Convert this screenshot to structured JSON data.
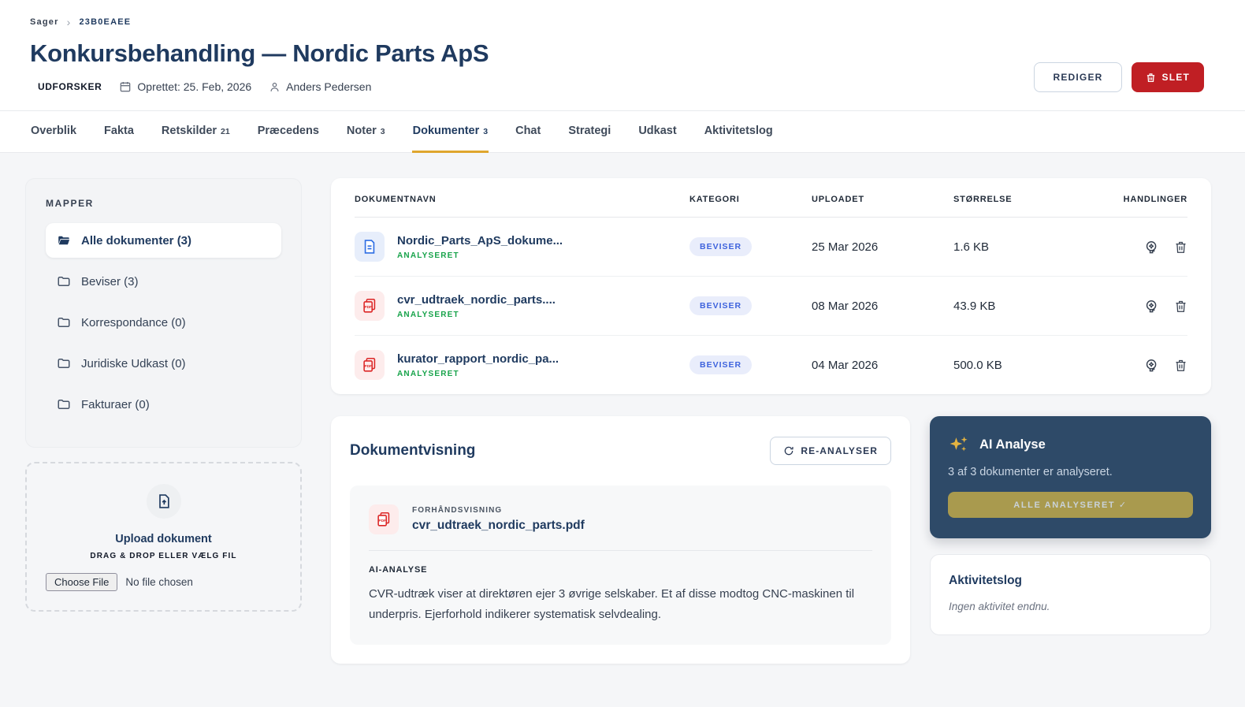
{
  "breadcrumb": {
    "root": "Sager",
    "separator": "›",
    "current": "23B0EAEE"
  },
  "header": {
    "title": "Konkursbehandling — Nordic Parts ApS",
    "role_badge": "UDFORSKER",
    "created": "Oprettet: 25. Feb, 2026",
    "owner": "Anders Pedersen",
    "edit_label": "REDIGER",
    "delete_label": "SLET"
  },
  "tabs": [
    {
      "label": "Overblik"
    },
    {
      "label": "Fakta"
    },
    {
      "label": "Retskilder",
      "count": "21"
    },
    {
      "label": "Præcedens"
    },
    {
      "label": "Noter",
      "count": "3"
    },
    {
      "label": "Dokumenter",
      "count": "3",
      "active": true
    },
    {
      "label": "Chat"
    },
    {
      "label": "Strategi"
    },
    {
      "label": "Udkast"
    },
    {
      "label": "Aktivitetslog"
    }
  ],
  "folders": {
    "title": "MAPPER",
    "items": [
      {
        "label": "Alle dokumenter (3)",
        "active": true
      },
      {
        "label": "Beviser (3)"
      },
      {
        "label": "Korrespondance (0)"
      },
      {
        "label": "Juridiske Udkast (0)"
      },
      {
        "label": "Fakturaer (0)"
      }
    ]
  },
  "upload": {
    "title": "Upload dokument",
    "subtitle": "DRAG & DROP ELLER VÆLG FIL",
    "file_button": "Choose File",
    "file_status": "No file chosen"
  },
  "table": {
    "headers": [
      "DOKUMENTNAVN",
      "KATEGORI",
      "UPLOADET",
      "STØRRELSE",
      "HANDLINGER"
    ],
    "rows": [
      {
        "name": "Nordic_Parts_ApS_dokume...",
        "status": "ANALYSERET",
        "category": "BEVISER",
        "uploaded": "25 Mar 2026",
        "size": "1.6 KB",
        "file_type": "doc"
      },
      {
        "name": "cvr_udtraek_nordic_parts....",
        "status": "ANALYSERET",
        "category": "BEVISER",
        "uploaded": "08 Mar 2026",
        "size": "43.9 KB",
        "file_type": "pdf"
      },
      {
        "name": "kurator_rapport_nordic_pa...",
        "status": "ANALYSERET",
        "category": "BEVISER",
        "uploaded": "04 Mar 2026",
        "size": "500.0 KB",
        "file_type": "pdf"
      }
    ]
  },
  "viewer": {
    "title": "Dokumentvisning",
    "reanalyze_label": "RE-ANALYSER",
    "preview_label": "FORHÅNDSVISNING",
    "preview_filename": "cvr_udtraek_nordic_parts.pdf",
    "analysis_label": "AI-ANALYSE",
    "analysis_text": "CVR-udtræk viser at direktøren ejer 3 øvrige selskaber. Et af disse modtog CNC-maskinen til underpris. Ejerforhold indikerer systematisk selvdealing."
  },
  "ai_panel": {
    "title": "AI Analyse",
    "status": "3 af 3 dokumenter er analyseret.",
    "button": "ALLE ANALYSERET ✓"
  },
  "activity": {
    "title": "Aktivitetslog",
    "empty": "Ingen aktivitet endnu."
  },
  "colors": {
    "navy": "#1f3a5f",
    "panel_navy": "#2e4a68",
    "amber_accent": "#dfa62e",
    "gold_button": "#a99a4e",
    "danger_red": "#c01f24",
    "badge_blue_text": "#3e63dd",
    "badge_blue_bg": "#e9edfb",
    "analyzed_green": "#17a34a",
    "page_bg": "#f5f6f8"
  }
}
